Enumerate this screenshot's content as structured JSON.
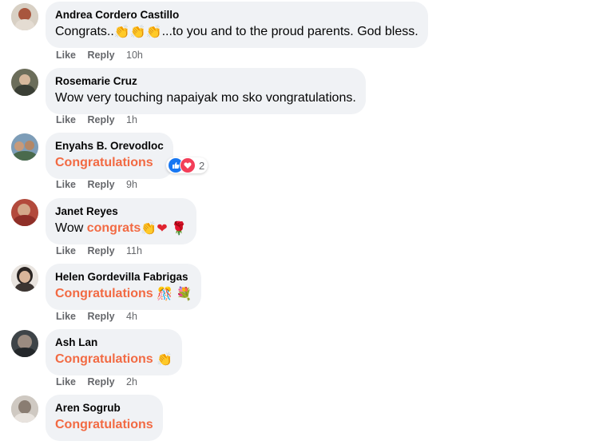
{
  "comments": [
    {
      "author": "Andrea Cordero Castillo",
      "text_before": "Congrats..",
      "emojis": [
        "👏",
        "👏",
        "👏"
      ],
      "text_after": "...to you and to the proud parents. God bless.",
      "actions": {
        "like": "Like",
        "reply": "Reply",
        "time": "10h"
      }
    },
    {
      "author": "Rosemarie Cruz",
      "text": "Wow very touching napaiyak mo sko vongratulations.",
      "actions": {
        "like": "Like",
        "reply": "Reply",
        "time": "1h"
      }
    },
    {
      "author": "Enyahs B. Orevodloc",
      "text": "Congratulations",
      "reactions": {
        "icons": [
          "like-reaction",
          "love-reaction"
        ],
        "count": "2"
      },
      "actions": {
        "like": "Like",
        "reply": "Reply",
        "time": "9h"
      }
    },
    {
      "author": "Janet Reyes",
      "text_before": "Wow ",
      "highlight": "congrats",
      "emojis": [
        "👏",
        "❤",
        "🌹"
      ],
      "actions": {
        "like": "Like",
        "reply": "Reply",
        "time": "11h"
      }
    },
    {
      "author": "Helen Gordevilla Fabrigas",
      "text": "Congratulations",
      "emojis": [
        "🎊",
        "💐"
      ],
      "actions": {
        "like": "Like",
        "reply": "Reply",
        "time": "4h"
      }
    },
    {
      "author": "Ash Lan",
      "text": "Congratulations",
      "emojis": [
        "👏"
      ],
      "actions": {
        "like": "Like",
        "reply": "Reply",
        "time": "2h"
      }
    },
    {
      "author": "Aren Sogrub",
      "text": "Congratulations"
    }
  ],
  "colors": {
    "highlight": "#f26a43",
    "bubble": "#f0f2f5",
    "meta": "#65676b",
    "like_blue": "#1877f2",
    "love_red": "#f33e58"
  }
}
